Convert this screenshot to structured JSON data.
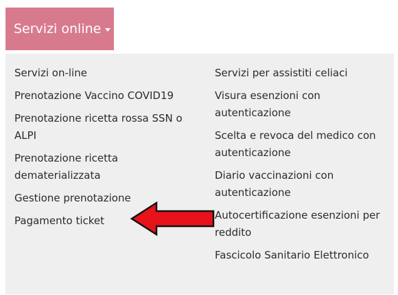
{
  "menu": {
    "button_label": "Servizi online",
    "caret_icon": "caret-down-icon",
    "accent_color": "#d87a8e"
  },
  "dropdown": {
    "left_items": [
      {
        "label": "Servizi on-line"
      },
      {
        "label": "Prenotazione Vaccino COVID19"
      },
      {
        "label": "Prenotazione ricetta rossa SSN o ALPI"
      },
      {
        "label": "Prenotazione ricetta dematerializzata"
      },
      {
        "label": "Gestione prenotazione"
      },
      {
        "label": "Pagamento ticket"
      }
    ],
    "right_items": [
      {
        "label": "Servizi per assistiti celiaci"
      },
      {
        "label": "Visura esenzioni con autenticazione"
      },
      {
        "label": "Scelta e revoca del medico con autenticazione"
      },
      {
        "label": "Diario vaccinazioni con autenticazione"
      },
      {
        "label": "Autocertificazione esenzioni per reddito"
      },
      {
        "label": "Fascicolo Sanitario Elettronico"
      }
    ]
  },
  "annotation": {
    "arrow_icon": "red-arrow-icon",
    "arrow_color": "#e8121a"
  }
}
